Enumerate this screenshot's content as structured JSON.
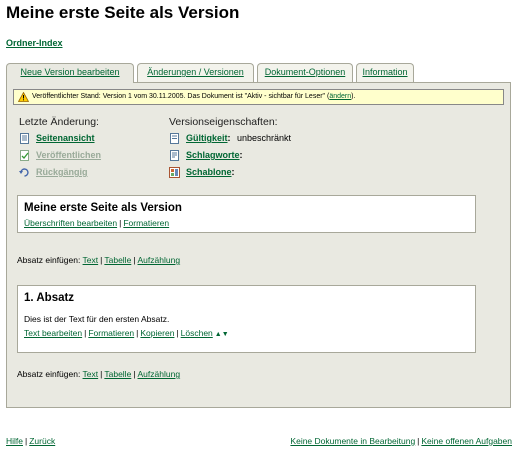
{
  "page_title": "Meine erste Seite als Version",
  "folder_index_link": "Ordner-Index",
  "tabs": [
    {
      "label": "Neue Version bearbeiten"
    },
    {
      "label": "Änderungen / Versionen"
    },
    {
      "label": "Dokument-Optionen"
    },
    {
      "label": "Information"
    }
  ],
  "notice": {
    "text": "Veröffentlichter Stand: Version 1 vom 30.11.2005.    Das Dokument ist \"Aktiv - sichtbar für Leser\" (",
    "link": "ändern",
    "suffix": ")."
  },
  "last_change": {
    "heading": "Letzte Änderung:",
    "items": [
      {
        "label": "Seitenansicht",
        "icon": "page-view-icon",
        "enabled": true
      },
      {
        "label": "Veröffentlichen",
        "icon": "publish-icon",
        "enabled": false
      },
      {
        "label": "Rückgängig",
        "icon": "undo-icon",
        "enabled": false
      }
    ]
  },
  "version_properties": {
    "heading": "Versionseigenschaften:",
    "items": [
      {
        "label": "Gültigkeit",
        "suffix": ":",
        "value": "unbeschränkt",
        "icon": "validity-icon"
      },
      {
        "label": "Schlagworte",
        "suffix": ":",
        "value": "",
        "icon": "keywords-icon"
      },
      {
        "label": "Schablone",
        "suffix": ":",
        "value": "",
        "icon": "template-icon"
      }
    ]
  },
  "header_box": {
    "title": "Meine erste Seite als Version",
    "edit_headings": "Überschriften bearbeiten",
    "format": "Formatieren"
  },
  "insert_paragraph": {
    "label": "Absatz einfügen:",
    "text": "Text",
    "table": "Tabelle",
    "list": "Aufzählung"
  },
  "paragraph_box": {
    "title": "1. Absatz",
    "body": "Dies ist der Text für den ersten Absatz.",
    "edit_text": "Text bearbeiten",
    "format": "Formatieren",
    "copy": "Kopieren",
    "delete": "Löschen",
    "arrows": "▲▼"
  },
  "footer": {
    "help": "Hilfe",
    "back": "Zurück",
    "no_documents": "Keine Dokumente in Bearbeitung",
    "no_tasks": "Keine offenen Aufgaben"
  },
  "colors": {
    "link": "#006633",
    "panel": "#e9e9e1",
    "notice_bg": "#ffffcc"
  }
}
